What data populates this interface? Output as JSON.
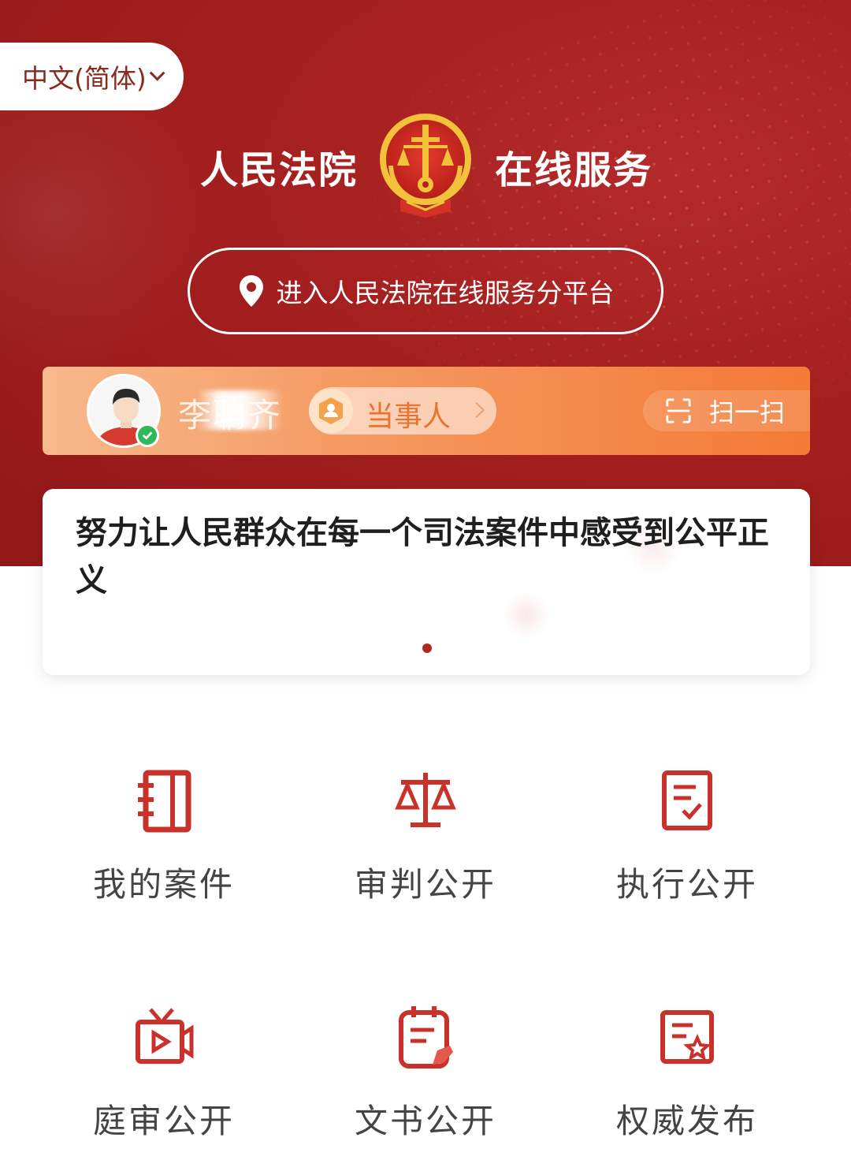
{
  "language_selector": {
    "label": "中文(简体)"
  },
  "header": {
    "title_left": "人民法院",
    "title_right": "在线服务",
    "emblem": "court-emblem"
  },
  "entry_button": {
    "label": "进入人民法院在线服务分平台",
    "icon": "location-pin-icon"
  },
  "user_bar": {
    "name": "李聃齐",
    "role": "当事人",
    "verified": true,
    "scan_label": "扫一扫"
  },
  "slogan": {
    "text": "努力让人民群众在每一个司法案件中感受到公平正义",
    "page_count": 1,
    "active_page": 1
  },
  "services": [
    {
      "label": "我的案件",
      "icon": "case-folder-icon"
    },
    {
      "label": "审判公开",
      "icon": "scales-icon"
    },
    {
      "label": "执行公开",
      "icon": "checklist-icon"
    },
    {
      "label": "庭审公开",
      "icon": "tv-play-icon"
    },
    {
      "label": "文书公开",
      "icon": "document-edit-icon"
    },
    {
      "label": "权威发布",
      "icon": "certificate-star-icon"
    }
  ],
  "colors": {
    "brand_red": "#a41f1f",
    "accent_orange": "#f47a36",
    "icon_red": "#c8322a"
  }
}
